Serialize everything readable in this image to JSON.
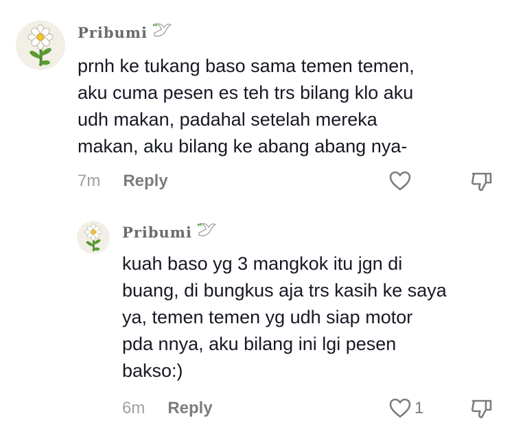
{
  "comments": [
    {
      "username": "Pribumi",
      "text": "prnh ke tukang baso sama temen temen,\naku cuma pesen es teh trs bilang klo aku\nudh makan, padahal setelah mereka\nmakan, aku bilang ke abang abang nya-",
      "time": "7m",
      "reply_label": "Reply",
      "like_count": ""
    }
  ],
  "replies": [
    {
      "username": "Pribumi",
      "text": "kuah baso yg 3 mangkok itu jgn di\nbuang, di bungkus aja trs kasih ke saya\nya, temen temen yg udh siap motor\npda nnya, aku bilang ini lgi pesen\nbakso:)",
      "time": "6m",
      "reply_label": "Reply",
      "like_count": "1"
    }
  ],
  "icons": {
    "like": "heart-outline-icon",
    "dislike": "thumbs-down-icon",
    "badge": "dove-icon"
  },
  "colors": {
    "text": "#161823",
    "muted": "#a0a0a0",
    "reply": "#7c7c7c"
  }
}
